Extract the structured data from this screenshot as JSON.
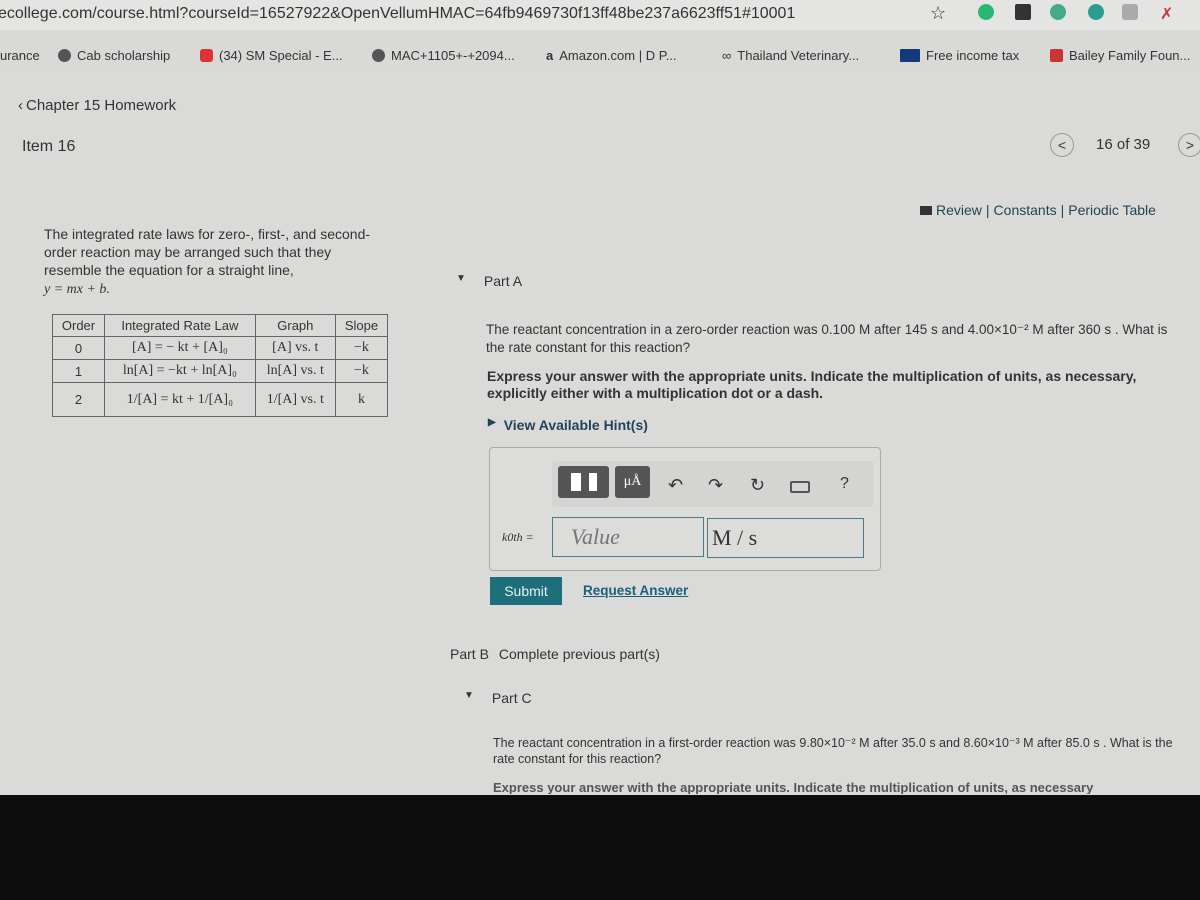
{
  "browser": {
    "url": "ecollege.com/course.html?courseId=16527922&OpenVellumHMAC=64fb9469730f13ff48be237a6623ff51#10001",
    "bookmarks": [
      {
        "label": "urance",
        "icon": ""
      },
      {
        "label": "Cab scholarship",
        "icon": "globe-icon"
      },
      {
        "label": "(34) SM Special - E...",
        "icon": "youtube-icon"
      },
      {
        "label": "MAC+1105+-+2094...",
        "icon": "globe-icon"
      },
      {
        "label": "Amazon.com | D P...",
        "icon": "amazon-icon"
      },
      {
        "label": "Thailand Veterinary...",
        "icon": "link-icon"
      },
      {
        "label": "Free income tax",
        "icon": "hcc-icon"
      },
      {
        "label": "Bailey Family Foun...",
        "icon": "bookmark-icon"
      }
    ]
  },
  "header": {
    "back_link": "Chapter 15 Homework",
    "item": "Item 16",
    "pager": "16 of 39"
  },
  "resources": {
    "review": "Review",
    "constants": "Constants",
    "periodic": "Periodic Table",
    "sep": "|"
  },
  "intro": {
    "text": "The integrated rate laws for zero-, first-, and second-order reaction may be arranged such that they resemble the equation for a straight line,",
    "equation": "y = mx + b."
  },
  "table": {
    "headers": [
      "Order",
      "Integrated Rate Law",
      "Graph",
      "Slope"
    ],
    "rows": [
      [
        "0",
        "[A] = − kt + [A]₀",
        "[A] vs. t",
        "−k"
      ],
      [
        "1",
        "ln[A] = −kt + ln[A]₀",
        "ln[A] vs. t",
        "−k"
      ],
      [
        "2",
        "1/[A] = kt + 1/[A]₀",
        "1/[A] vs. t",
        "k"
      ]
    ]
  },
  "partA": {
    "title": "Part A",
    "question": "The reactant concentration in a zero-order reaction was 0.100 M after 145 s and 4.00×10⁻² M after 360 s . What is the rate constant for this reaction?",
    "instructions": "Express your answer with the appropriate units. Indicate the multiplication of units, as necessary, explicitly either with a multiplication dot or a dash.",
    "hints": "View Available Hint(s)",
    "var_label": "k0th =",
    "value_placeholder": "Value",
    "units": "M / s",
    "toolbar": {
      "units_btn": "μÅ",
      "help": "?"
    },
    "submit": "Submit",
    "request": "Request Answer"
  },
  "partB": {
    "title": "Part B",
    "status": "Complete previous part(s)"
  },
  "partC": {
    "title": "Part C",
    "question": "The reactant concentration in a first-order reaction was 9.80×10⁻² M after 35.0 s and 8.60×10⁻³ M after 85.0 s . What is the rate constant for this reaction?",
    "instructions": "Express your answer with the appropriate units. Indicate the multiplication of units, as necessary"
  }
}
